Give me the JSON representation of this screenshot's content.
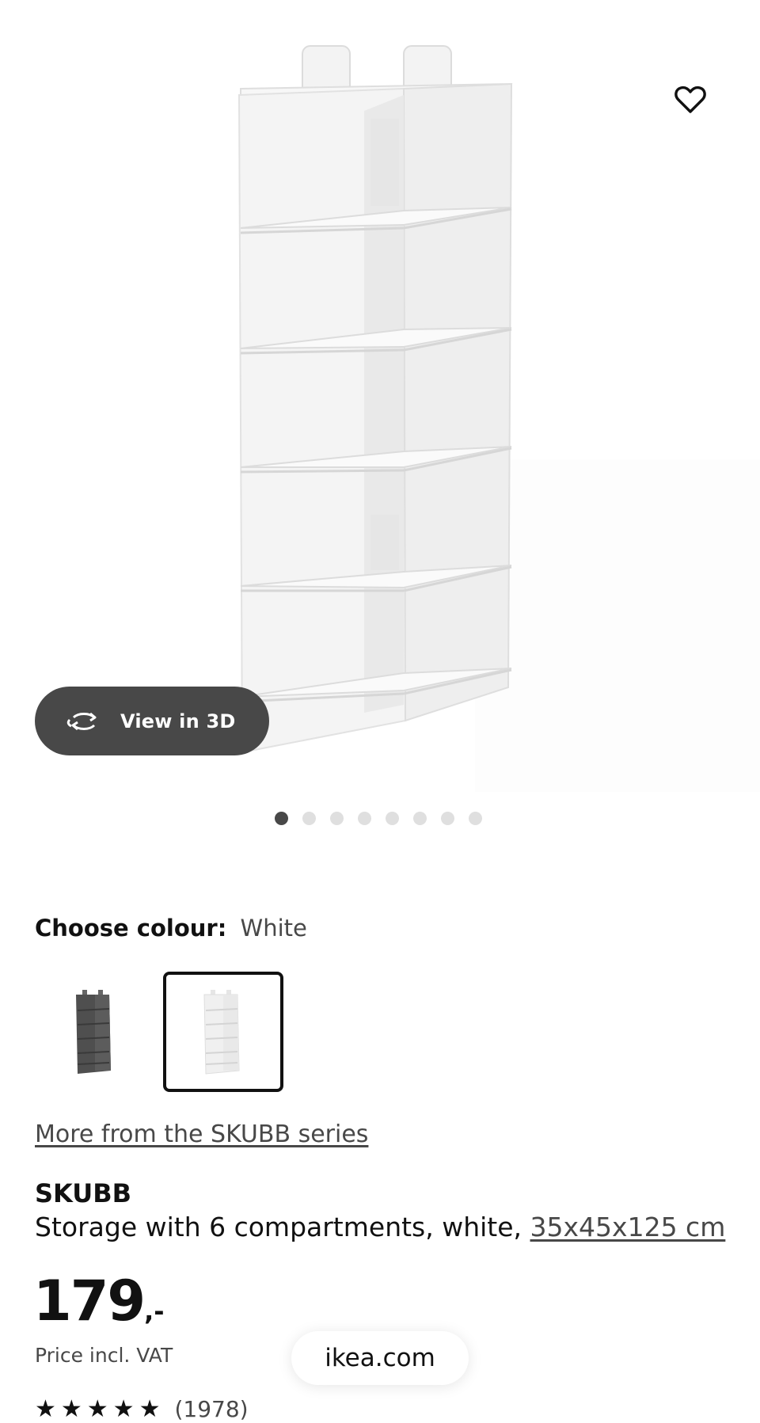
{
  "gallery": {
    "view3d_label": "View in 3D",
    "view3d_icon": "rotate-3d-icon",
    "wishlist_icon": "heart-outline-icon",
    "active_dot": 1,
    "dot_count": 8
  },
  "colour": {
    "label": "Choose colour:",
    "selected_value": "White",
    "options": [
      {
        "name": "dark-grey",
        "color": "#555555"
      },
      {
        "name": "white",
        "color": "#f2f2f2",
        "selected": true
      }
    ]
  },
  "series_link": "More from the SKUBB series",
  "product": {
    "name": "SKUBB",
    "description": "Storage with 6 compartments, white, ",
    "dimensions": "35x45x125 cm"
  },
  "price": {
    "integer": "179",
    "decimals": ",-",
    "note": "Price incl. VAT"
  },
  "rating": {
    "stars": "★★★★★",
    "count": "(1978)"
  },
  "browser": {
    "url": "ikea.com"
  }
}
